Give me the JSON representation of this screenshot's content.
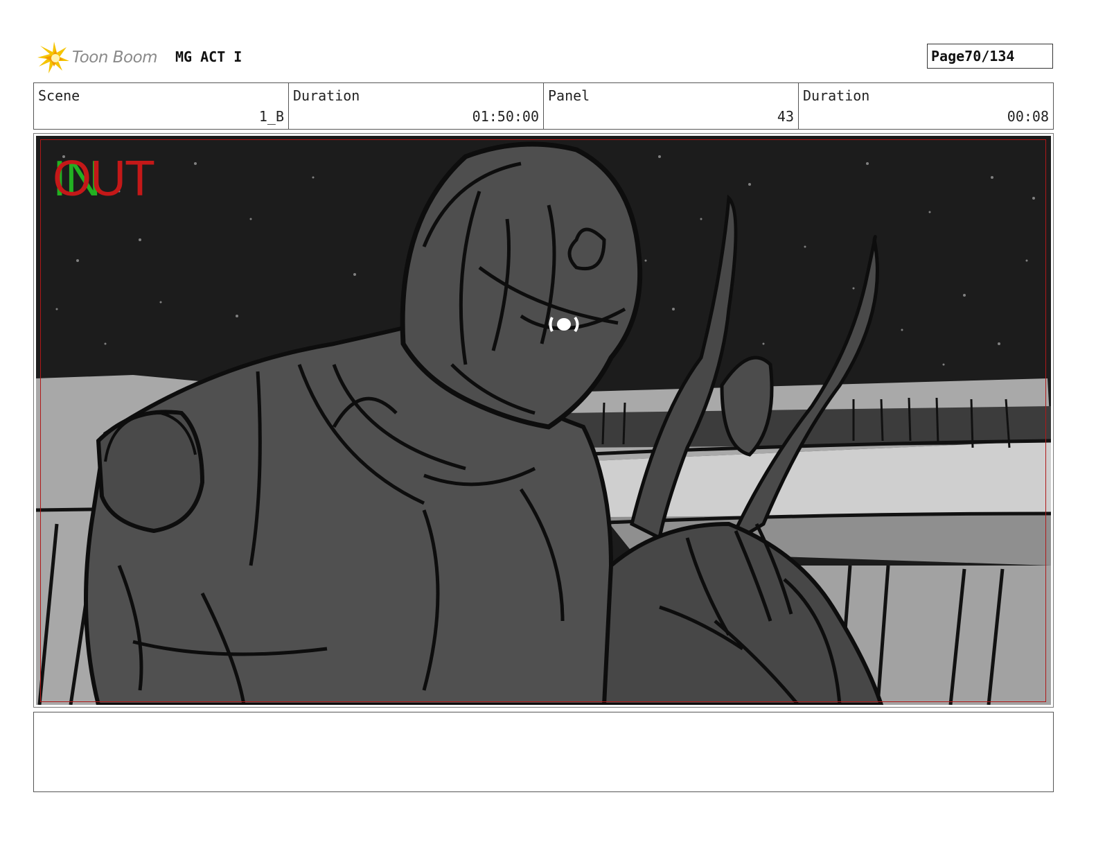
{
  "header": {
    "logo_text": "Toon Boom",
    "project_title": "MG ACT I",
    "page_label": "Page",
    "page_number": "70/134"
  },
  "info": {
    "scene_label": "Scene",
    "scene_value": "1_B",
    "scene_duration_label": "Duration",
    "scene_duration_value": "01:50:00",
    "panel_label": "Panel",
    "panel_value": "43",
    "panel_duration_label": "Duration",
    "panel_duration_value": "00:08"
  },
  "panel": {
    "in_text": "IN",
    "out_text": "OUT"
  },
  "colors": {
    "safe_area": "#b01818",
    "in_marker": "#22b022",
    "out_marker": "#c41818",
    "logo_star": "#f5c400"
  },
  "notes": {
    "text": ""
  }
}
